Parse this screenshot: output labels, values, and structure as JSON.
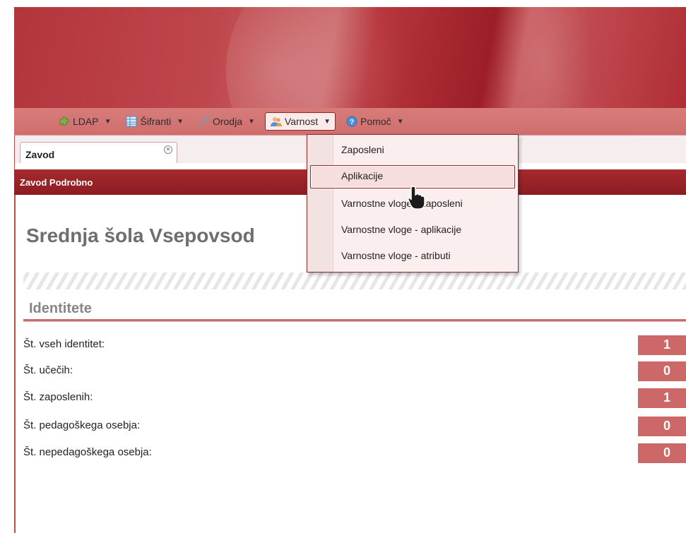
{
  "menu": {
    "items": [
      {
        "label": "LDAP",
        "icon": "puzzle-icon"
      },
      {
        "label": "Šifranti",
        "icon": "table-icon"
      },
      {
        "label": "Orodja",
        "icon": "wrench-icon"
      },
      {
        "label": "Varnost",
        "icon": "users-icon"
      },
      {
        "label": "Pomoč",
        "icon": "help-icon"
      }
    ],
    "active": "Varnost"
  },
  "tab": {
    "label": "Zavod"
  },
  "panel": {
    "title": "Zavod Podrobno"
  },
  "school": {
    "name": "Srednja šola Vsepovsod"
  },
  "identities": {
    "heading": "Identitete",
    "rows": [
      {
        "label": "Št. vseh identitet:",
        "value": "1"
      },
      {
        "label": "Št. učečih:",
        "value": "0"
      },
      {
        "label": "Št. zaposlenih:",
        "value": "1"
      },
      {
        "label": "Št. pedagoškega osebja:",
        "value": "0"
      },
      {
        "label": "Št. nepedagoškega osebja:",
        "value": "0"
      }
    ]
  },
  "dropdown": {
    "items": [
      {
        "label": "Zaposleni"
      },
      {
        "label": "Aplikacije"
      },
      {
        "label": "Varnostne vloge - zaposleni"
      },
      {
        "label": "Varnostne vloge - aplikacije"
      },
      {
        "label": "Varnostne vloge - atributi"
      }
    ],
    "hovered": "Aplikacije"
  },
  "colors": {
    "brand": "#b3353c",
    "panel_header": "#9a2228",
    "badge": "#cc6868"
  }
}
